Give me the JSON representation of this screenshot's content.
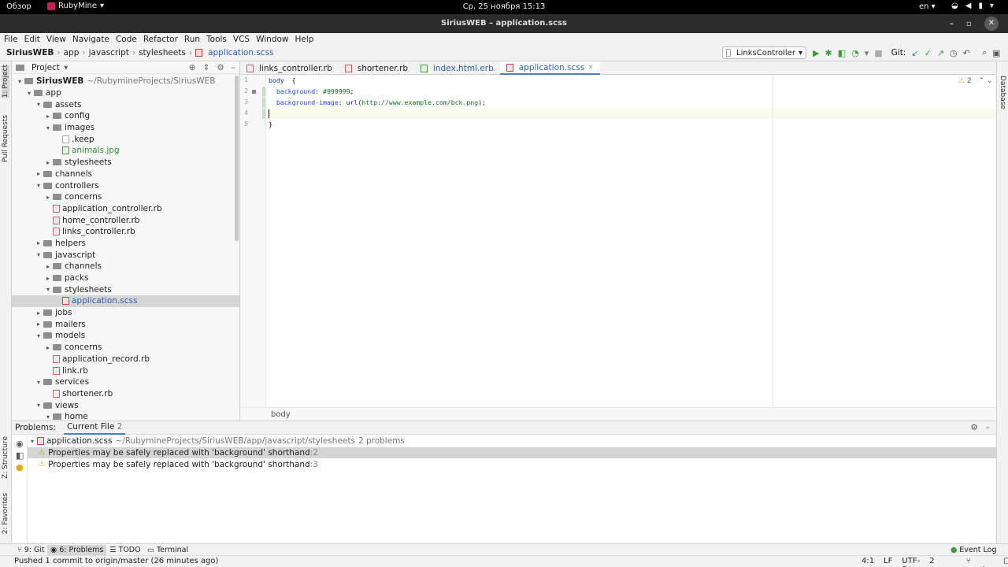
{
  "system_bar": {
    "activities": "Обзор",
    "app_name": "RubyMine",
    "clock": "Ср, 25 ноября  15:13",
    "lang": "en"
  },
  "window": {
    "title": "SiriusWEB – application.scss"
  },
  "menu": [
    "File",
    "Edit",
    "View",
    "Navigate",
    "Code",
    "Refactor",
    "Run",
    "Tools",
    "VCS",
    "Window",
    "Help"
  ],
  "nav": {
    "crumbs": [
      "SiriusWEB",
      "app",
      "javascript",
      "stylesheets",
      "application.scss"
    ],
    "run_config": "LinksController",
    "git_label": "Git:"
  },
  "left_stripe": {
    "project": "1: Project",
    "pull": "Pull Requests",
    "structure": "Z: Structure",
    "favorites": "2: Favorites"
  },
  "right_stripe": {
    "database": "Database"
  },
  "project_panel": {
    "title": "Project",
    "tree": [
      {
        "label": "SiriusWEB",
        "extra": "~/RubymineProjects/SiriusWEB",
        "depth": 0,
        "kind": "folder",
        "open": true,
        "bold": true
      },
      {
        "label": "app",
        "depth": 1,
        "kind": "folder",
        "open": true
      },
      {
        "label": "assets",
        "depth": 2,
        "kind": "folder",
        "open": true
      },
      {
        "label": "config",
        "depth": 3,
        "kind": "folder",
        "open": false
      },
      {
        "label": "images",
        "depth": 3,
        "kind": "folder",
        "open": true
      },
      {
        "label": ".keep",
        "depth": 4,
        "kind": "file"
      },
      {
        "label": "animals.jpg",
        "depth": 4,
        "kind": "img",
        "color": "green"
      },
      {
        "label": "stylesheets",
        "depth": 3,
        "kind": "folder",
        "open": false
      },
      {
        "label": "channels",
        "depth": 2,
        "kind": "folder",
        "open": false
      },
      {
        "label": "controllers",
        "depth": 2,
        "kind": "folder",
        "open": true
      },
      {
        "label": "concerns",
        "depth": 3,
        "kind": "folder",
        "open": false
      },
      {
        "label": "application_controller.rb",
        "depth": 3,
        "kind": "rb",
        "leaf": true
      },
      {
        "label": "home_controller.rb",
        "depth": 3,
        "kind": "rb",
        "leaf": true
      },
      {
        "label": "links_controller.rb",
        "depth": 3,
        "kind": "rb",
        "leaf": true
      },
      {
        "label": "helpers",
        "depth": 2,
        "kind": "folder",
        "open": false
      },
      {
        "label": "javascript",
        "depth": 2,
        "kind": "folder",
        "open": true
      },
      {
        "label": "channels",
        "depth": 3,
        "kind": "folder",
        "open": false
      },
      {
        "label": "packs",
        "depth": 3,
        "kind": "folder",
        "open": false
      },
      {
        "label": "stylesheets",
        "depth": 3,
        "kind": "folder",
        "open": true
      },
      {
        "label": "application.scss",
        "depth": 4,
        "kind": "css",
        "color": "blue",
        "selected": true
      },
      {
        "label": "jobs",
        "depth": 2,
        "kind": "folder",
        "open": false
      },
      {
        "label": "mailers",
        "depth": 2,
        "kind": "folder",
        "open": false
      },
      {
        "label": "models",
        "depth": 2,
        "kind": "folder",
        "open": true
      },
      {
        "label": "concerns",
        "depth": 3,
        "kind": "folder",
        "open": false
      },
      {
        "label": "application_record.rb",
        "depth": 3,
        "kind": "rb",
        "leaf": true
      },
      {
        "label": "link.rb",
        "depth": 3,
        "kind": "rb",
        "leaf": true
      },
      {
        "label": "services",
        "depth": 2,
        "kind": "folder",
        "open": true
      },
      {
        "label": "shortener.rb",
        "depth": 3,
        "kind": "rb",
        "leaf": true
      },
      {
        "label": "views",
        "depth": 2,
        "kind": "folder",
        "open": true
      },
      {
        "label": "home",
        "depth": 3,
        "kind": "folder",
        "open": true
      }
    ]
  },
  "tabs": [
    {
      "label": "links_controller.rb",
      "kind": "rb"
    },
    {
      "label": "shortener.rb",
      "kind": "rb"
    },
    {
      "label": "index.html.erb",
      "kind": "erb",
      "color": "blue"
    },
    {
      "label": "application.scss",
      "kind": "css",
      "color": "blue",
      "active": true
    }
  ],
  "editor": {
    "warnings": "2",
    "lines": [
      {
        "n": "1",
        "parts": [
          [
            "kw",
            "body"
          ],
          [
            "",
            "  {"
          ]
        ]
      },
      {
        "n": "2",
        "parts": [
          [
            "",
            "  "
          ],
          [
            "prop",
            "background"
          ],
          [
            "",
            ": "
          ],
          [
            "val",
            "#999999"
          ],
          [
            "",
            ";"
          ]
        ]
      },
      {
        "n": "3",
        "parts": [
          [
            "",
            "  "
          ],
          [
            "prop",
            "background-image"
          ],
          [
            "",
            ": "
          ],
          [
            "kw",
            "url"
          ],
          [
            "",
            "("
          ],
          [
            "val",
            "http://www.example.com/bck.png"
          ],
          [
            "",
            ");"
          ]
        ]
      },
      {
        "n": "4",
        "parts": []
      },
      {
        "n": "5",
        "parts": [
          [
            "",
            "}"
          ]
        ]
      }
    ],
    "breadcrumb": "body"
  },
  "problems": {
    "label": "Problems:",
    "tab": "Current File",
    "tab_count": "2",
    "file": "application.scss",
    "path": "~/RubymineProjects/SiriusWEB/app/javascript/stylesheets",
    "count": "2 problems",
    "items": [
      {
        "text": "Properties may be safely replaced with 'background' shorthand",
        "line": ":2",
        "selected": true
      },
      {
        "text": "Properties may be safely replaced with 'background' shorthand",
        "line": ":3"
      }
    ]
  },
  "toolwindows": [
    {
      "label": "9: Git"
    },
    {
      "label": "6: Problems",
      "active": true
    },
    {
      "label": "TODO"
    },
    {
      "label": "Terminal"
    }
  ],
  "event_log": "Event Log",
  "status": {
    "message": "Pushed 1 commit to origin/master (26 minutes ago)",
    "pos": "4:1",
    "lf": "LF",
    "enc": "UTF-8",
    "indent": "2 spaces",
    "branch": "master"
  }
}
